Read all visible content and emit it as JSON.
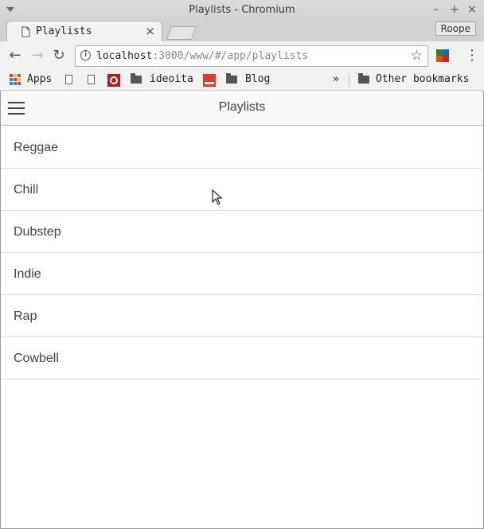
{
  "window": {
    "title": "Playlists - Chromium",
    "controls": {
      "minimize": "–",
      "maximize": "+",
      "close": "×"
    }
  },
  "tabs": {
    "active": {
      "title": "Playlists",
      "icon": "document-icon",
      "close": "×"
    },
    "profile_label": "Roope"
  },
  "toolbar": {
    "back": "←",
    "forward": "→",
    "reload": "↻",
    "url_host": "localhost",
    "url_rest": ":3000/www/#/app/playlists",
    "star": "☆",
    "menu": "⋮"
  },
  "bookmarks": {
    "apps_label": "Apps",
    "items": [
      {
        "label": "ideoita",
        "type": "folder"
      },
      {
        "label": "Blog",
        "type": "folder"
      }
    ],
    "overflow": "»",
    "other_label": "Other bookmarks"
  },
  "app": {
    "header_title": "Playlists",
    "playlists": [
      "Reggae",
      "Chill",
      "Dubstep",
      "Indie",
      "Rap",
      "Cowbell"
    ]
  },
  "colors": {
    "header_bg": "#f8f8f8",
    "item_text": "#444444",
    "divider": "#dddddd"
  }
}
